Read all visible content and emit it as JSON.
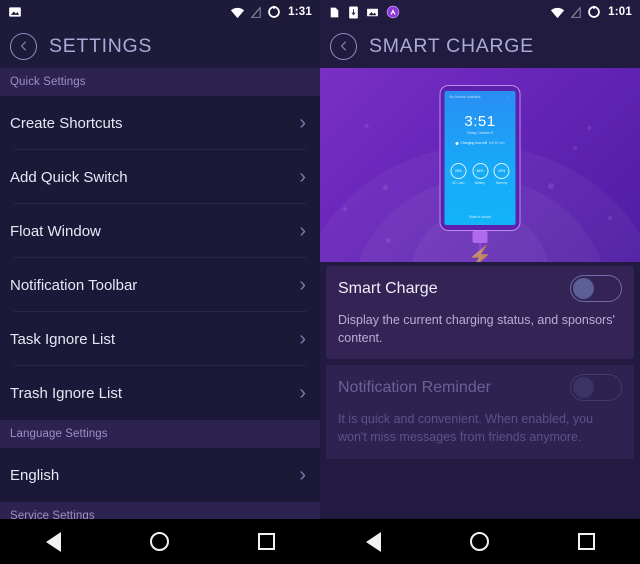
{
  "left": {
    "statusbar": {
      "time": "1:31",
      "icons_left": [
        "image-icon"
      ],
      "icons_right": [
        "wifi-icon",
        "signal-off-icon",
        "battery-ring-icon"
      ]
    },
    "appbar": {
      "back": "back-chevron-icon",
      "title": "SETTINGS"
    },
    "sections": [
      {
        "header": "Quick Settings",
        "items": [
          {
            "label": "Create Shortcuts"
          },
          {
            "label": "Add Quick Switch"
          },
          {
            "label": "Float Window"
          },
          {
            "label": "Notification Toolbar"
          },
          {
            "label": "Task Ignore List"
          },
          {
            "label": "Trash Ignore List"
          }
        ]
      },
      {
        "header": "Language Settings",
        "items": [
          {
            "label": "English"
          }
        ]
      },
      {
        "header": "Service Settings",
        "items": []
      }
    ],
    "chevron": "›"
  },
  "right": {
    "statusbar": {
      "time": "1:01",
      "icons_left": [
        "sd-card-icon",
        "usb-device-icon",
        "image-icon",
        "app-badge-icon"
      ],
      "icons_right": [
        "wifi-icon",
        "signal-off-icon",
        "battery-ring-icon"
      ]
    },
    "appbar": {
      "back": "back-chevron-icon",
      "title": "SMART CHARGE"
    },
    "banner": {
      "device_screen": {
        "status_left": "No Service Available",
        "clock": "3:51",
        "date": "Friday, October 6",
        "charging": "Charging now will",
        "charging_extra": "full 30 min",
        "rings": [
          {
            "value": "28%",
            "caption": "SD Card"
          },
          {
            "value": "86%",
            "caption": "Battery"
          },
          {
            "value": "63%",
            "caption": "Memory"
          }
        ],
        "footer": "Slide to unlock"
      }
    },
    "cards": [
      {
        "title": "Smart Charge",
        "desc": "Display the current charging status, and sponsors' content.",
        "toggle_state": "off",
        "enabled": true
      },
      {
        "title": "Notification Reminder",
        "desc": "It is quick and convenient. When enabled, you won't miss messages from friends anymore.",
        "toggle_state": "off",
        "enabled": false
      }
    ]
  },
  "navbar": {
    "back": "back-triangle-icon",
    "home": "home-circle-icon",
    "recents": "recents-square-icon"
  },
  "colors": {
    "left_bg": "#1b1838",
    "right_bg": "#231a42",
    "section_head_bg": "#2d2350",
    "card_bg": "#332455",
    "accent_purple": "#7a2fc4",
    "screen_blue": "#17a9f7",
    "title_text": "#a9abd6"
  }
}
